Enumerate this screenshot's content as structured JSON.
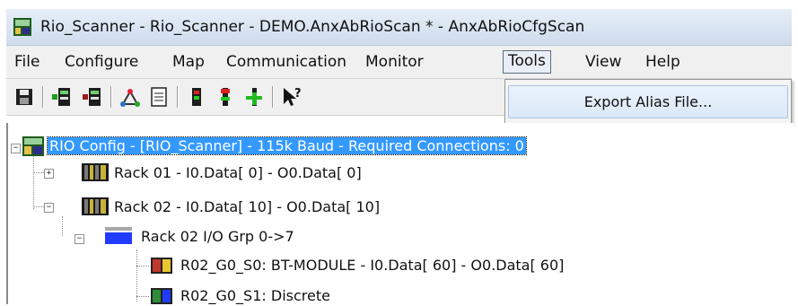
{
  "window": {
    "title": "Rio_Scanner - Rio_Scanner - DEMO.AnxAbRioScan * - AnxAbRioCfgScan"
  },
  "menu": {
    "items": [
      "File",
      "Configure",
      "Map",
      "Communication",
      "Monitor",
      "Tools",
      "View",
      "Help"
    ],
    "active": "Tools"
  },
  "toolbar": {
    "buttons": [
      "save-icon",
      "upload-icon",
      "download-icon",
      "network-icon",
      "document-icon",
      "status-red-icon",
      "status-run-icon",
      "add-green-icon",
      "help-pointer-icon"
    ]
  },
  "tools_menu": {
    "export_alias": "Export Alias File..."
  },
  "tree": {
    "root": "RIO Config - [RIO_Scanner] - 115k Baud - Required Connections: 0",
    "rack01": "Rack 01 - I0.Data[ 0] - O0.Data[ 0]",
    "rack02": "Rack 02 - I0.Data[ 10] - O0.Data[ 10]",
    "group": "Rack 02 I/O Grp 0->7",
    "slot0": "R02_G0_S0: BT-MODULE - I0.Data[ 60] - O0.Data[ 60]",
    "slot1": "R02_G0_S1: Discrete"
  },
  "colors": {
    "selection": "#3399ff",
    "group_blue": "#1f3cff"
  }
}
